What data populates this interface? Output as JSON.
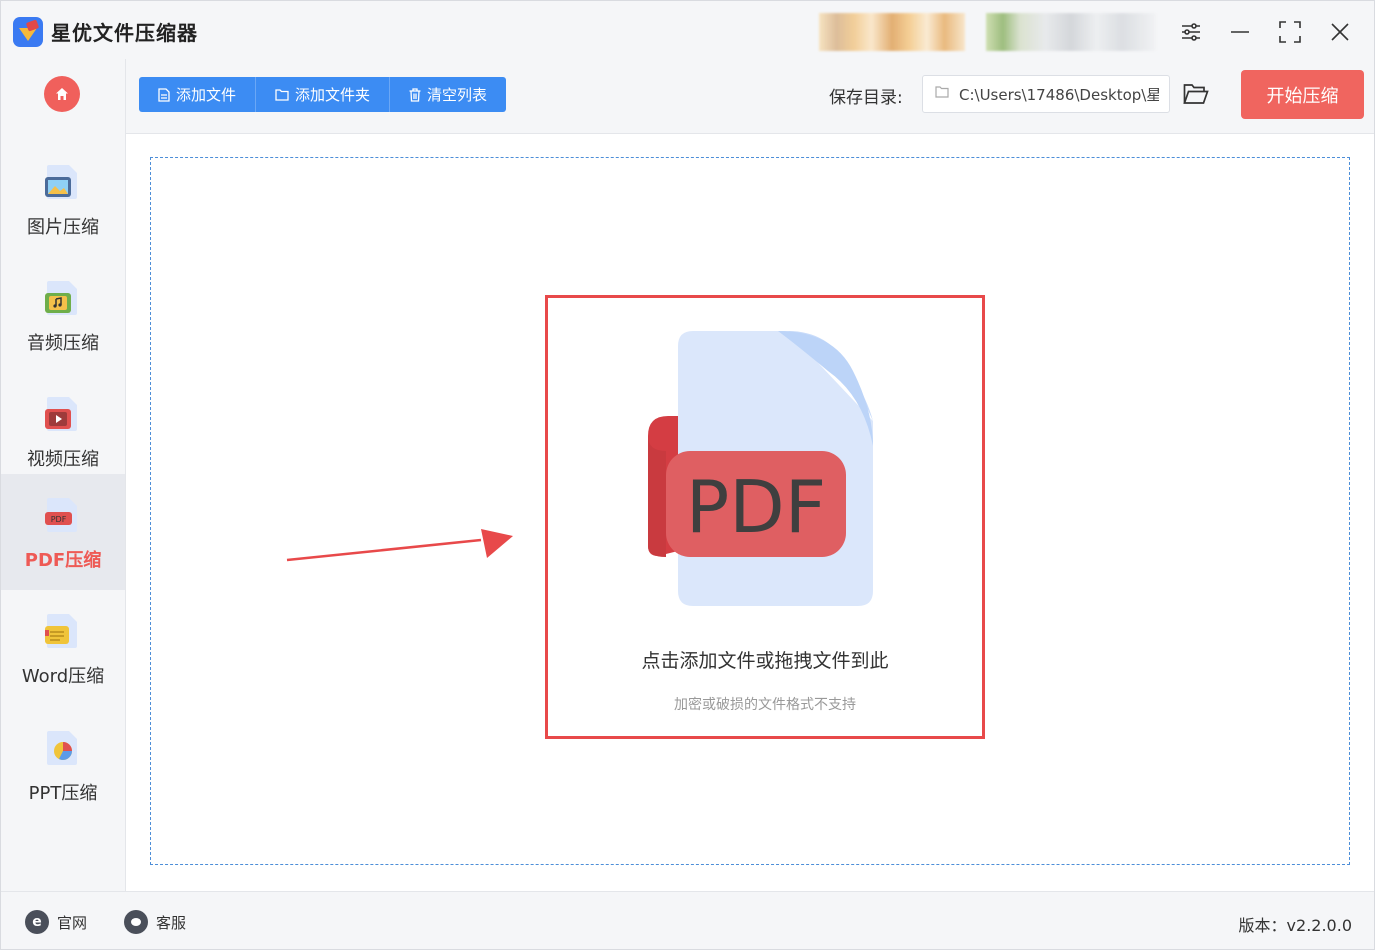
{
  "app": {
    "title": "星优文件压缩器"
  },
  "sidebar": {
    "items": [
      {
        "label": "图片压缩",
        "icon": "image-icon"
      },
      {
        "label": "音频压缩",
        "icon": "audio-icon"
      },
      {
        "label": "视频压缩",
        "icon": "video-icon"
      },
      {
        "label": "PDF压缩",
        "icon": "pdf-icon",
        "active": true
      },
      {
        "label": "Word压缩",
        "icon": "word-icon"
      },
      {
        "label": "PPT压缩",
        "icon": "ppt-icon"
      }
    ]
  },
  "toolbar": {
    "add_file": "添加文件",
    "add_folder": "添加文件夹",
    "clear_list": "清空列表",
    "save_label": "保存目录:",
    "save_path": "C:\\Users\\17486\\Desktop\\星",
    "start": "开始压缩"
  },
  "dropzone": {
    "icon_text": "PDF",
    "title": "点击添加文件或拖拽文件到此",
    "hint": "加密或破损的文件格式不支持"
  },
  "footer": {
    "website": "官网",
    "support": "客服",
    "version": "版本：v2.2.0.0"
  },
  "colors": {
    "accent_blue": "#3c8cf3",
    "accent_red": "#f0655f",
    "highlight_red": "#e8494a"
  }
}
